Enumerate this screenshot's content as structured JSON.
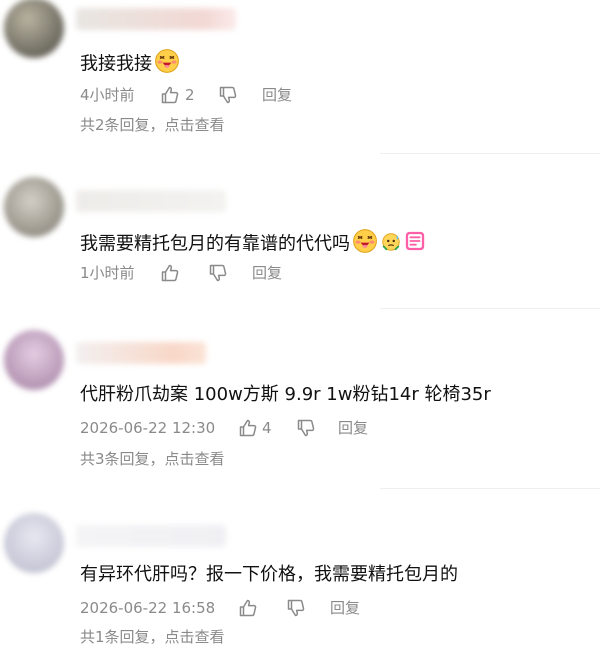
{
  "comments": [
    {
      "text": "我接我接",
      "emojis": [
        "laughing-blush-emoji"
      ],
      "time": "4小时前",
      "likes": "2",
      "reply_label": "回复",
      "replies_link": "共2条回复，点击查看"
    },
    {
      "text": "我需要精托包月的有靠谱的代代吗",
      "emojis": [
        "laughing-blush-emoji",
        "sweat-emoji",
        "sticker-emoji"
      ],
      "time": "1小时前",
      "likes": "",
      "reply_label": "回复"
    },
    {
      "text": "代肝粉爪劫案 100w方斯 9.9r 1w粉钻14r 轮椅35r",
      "time": "2026-06-22 12:30",
      "likes": "4",
      "reply_label": "回复",
      "replies_link": "共3条回复，点击查看"
    },
    {
      "text": "有异环代肝吗？报一下价格，我需要精托包月的",
      "time": "2026-06-22 16:58",
      "likes": "",
      "reply_label": "回复",
      "replies_link": "共1条回复，点击查看"
    }
  ],
  "colors": {
    "meta_text": "#8a8a8a",
    "comment_text": "#111111"
  }
}
